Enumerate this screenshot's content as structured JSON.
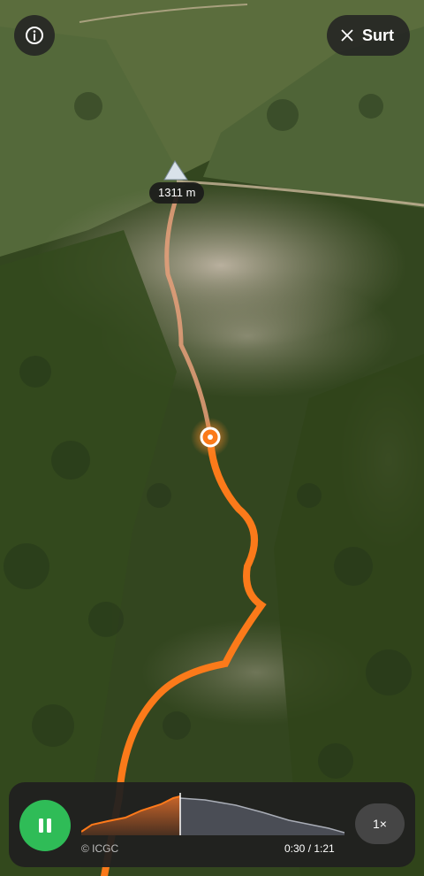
{
  "map": {
    "peak_label": "1311 m",
    "route_color": "#fb7a1a",
    "info_icon": "info-icon",
    "close_icon": "close-icon"
  },
  "header": {
    "exit_label": "Surt"
  },
  "player": {
    "state_icon": "pause-icon",
    "credit": "© ICGC",
    "time": "0:30 / 1:21",
    "progress": 0.37,
    "speed": "1×"
  }
}
